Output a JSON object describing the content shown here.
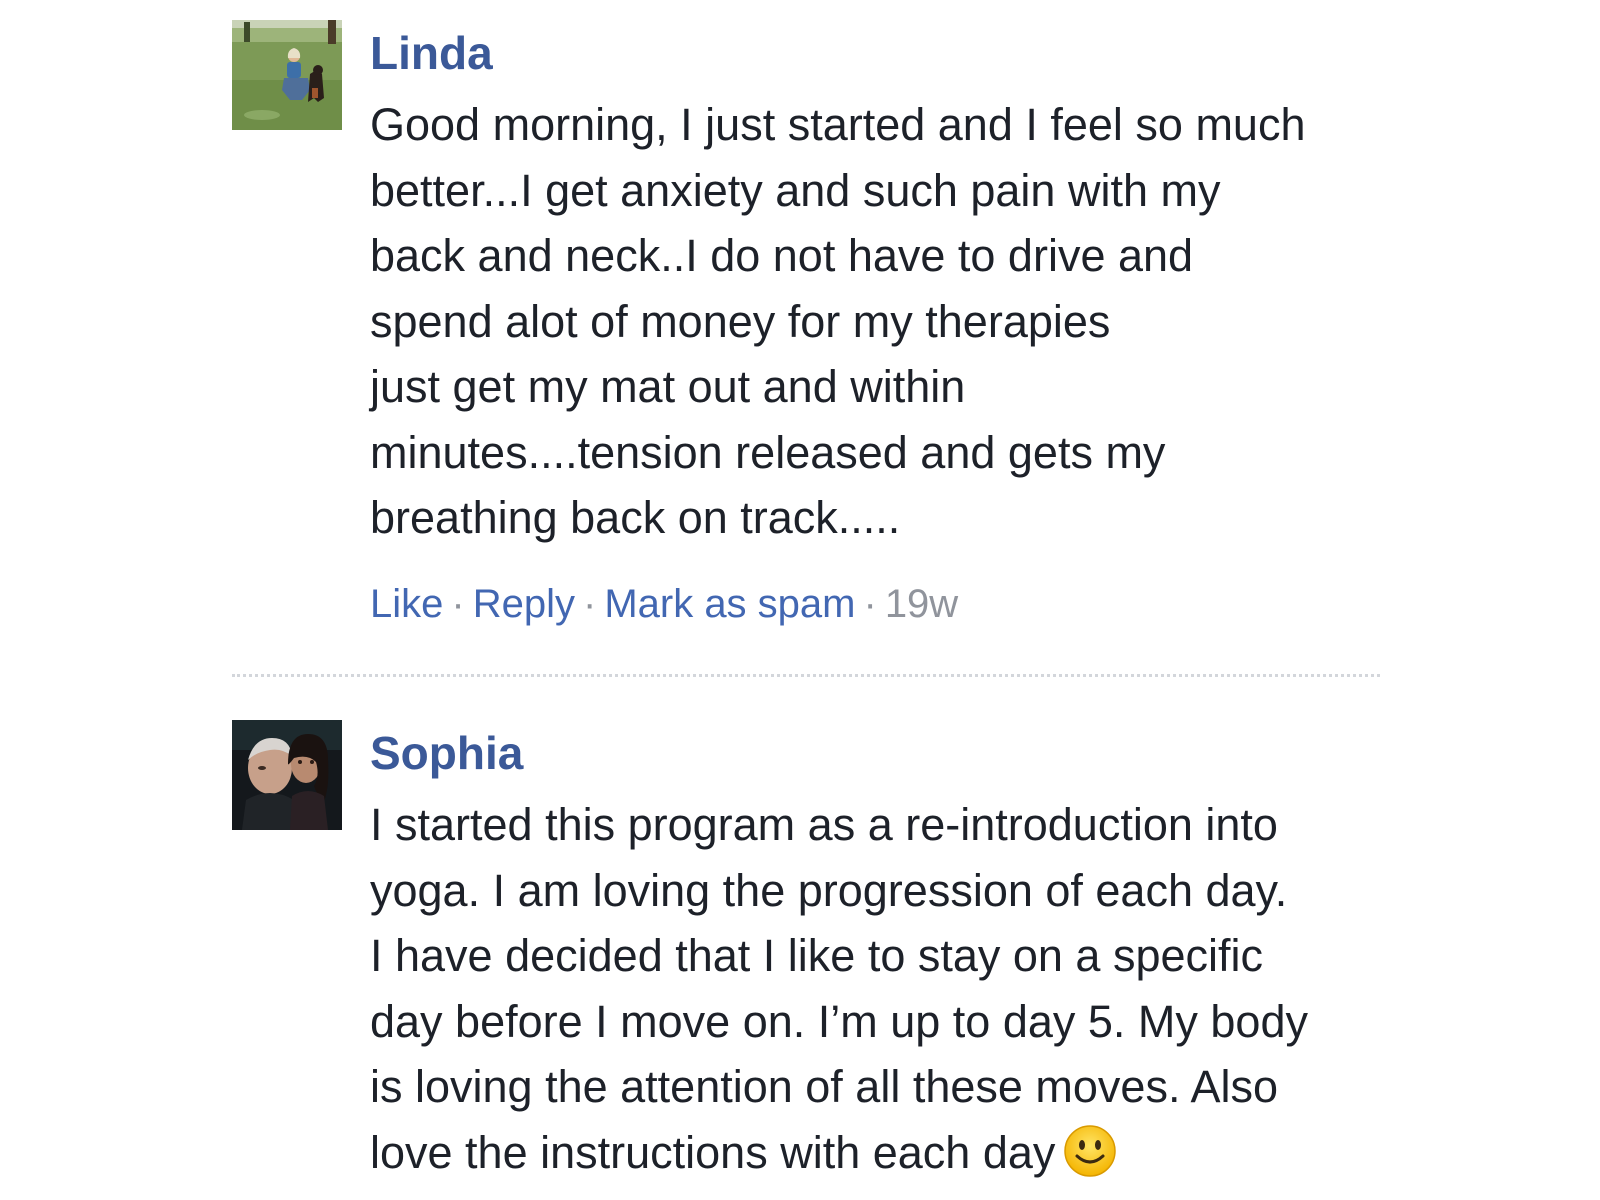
{
  "comments": [
    {
      "author": "Linda",
      "avatar_icon": "profile-photo-woman-with-dog",
      "text": "Good morning, I just started and I feel so much\nbetter...I get anxiety and such pain with my\nback and neck..I do not have to drive and\nspend alot of money for my therapies\njust get my mat out and within\nminutes....tension released and gets my\nbreathing back on track.....",
      "actions": {
        "like": "Like",
        "reply": "Reply",
        "spam": "Mark as spam",
        "separator": "·",
        "time": "19w"
      }
    },
    {
      "author": "Sophia",
      "avatar_icon": "profile-photo-couple",
      "text": "I started this program as a re-introduction into\nyoga. I am loving the progression of each day.\nI have decided that I like to stay on a specific\nday before I move on. I’m up to day 5. My body\nis loving the attention of all these moves. Also\nlove the instructions with each day",
      "emoji_icon": "smiley-face-emoji"
    }
  ],
  "colors": {
    "author_link": "#3b5998",
    "action_link": "#4267b2",
    "meta_gray": "#90949c",
    "text": "#1d2129",
    "divider": "#d3d6db"
  }
}
